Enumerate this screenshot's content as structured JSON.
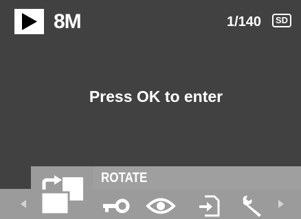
{
  "status_bar": {
    "mode_icon": "play-icon",
    "resolution": "8M",
    "image_counter": "1/140",
    "storage_badge": "SD"
  },
  "message": "Press OK to enter",
  "menu": {
    "selected_label": "ROTATE",
    "items": [
      {
        "name": "rotate",
        "icon": "rotate-icon"
      },
      {
        "name": "protect",
        "icon": "key-icon"
      },
      {
        "name": "view",
        "icon": "eye-icon"
      },
      {
        "name": "copy",
        "icon": "copy-to-card-icon"
      },
      {
        "name": "setup",
        "icon": "wrench-icon"
      }
    ],
    "prev_arrow": "chevron-left-icon",
    "next_arrow": "chevron-right-icon"
  },
  "colors": {
    "background": "#414141",
    "menu_strip": "#9b9b9b",
    "label_bar": "#9f9f9f",
    "foreground": "#ffffff"
  }
}
